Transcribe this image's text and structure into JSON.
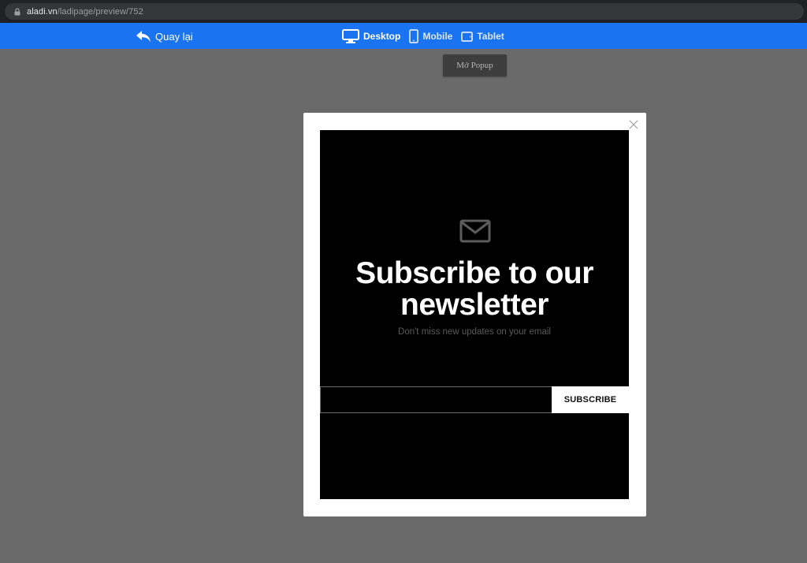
{
  "browser": {
    "url_domain": "aladi.vn",
    "url_path": "/ladipage/preview/752"
  },
  "toolbar": {
    "back_label": "Quay lại",
    "devices": [
      {
        "label": "Desktop",
        "icon": "desktop-icon",
        "active": true
      },
      {
        "label": "Mobile",
        "icon": "mobile-icon",
        "active": false
      },
      {
        "label": "Tablet",
        "icon": "tablet-icon",
        "active": false
      }
    ],
    "colors": {
      "bar": "#1a73f0"
    }
  },
  "preview": {
    "open_popup_label": "Mở Popup"
  },
  "popup": {
    "icon": "envelope-icon",
    "headline": "Subscribe to our newsletter",
    "subtext": "Don't miss new updates on your email",
    "email_value": "",
    "email_placeholder": "",
    "subscribe_label": "SUBSCRIBE",
    "close_icon": "close-icon"
  }
}
